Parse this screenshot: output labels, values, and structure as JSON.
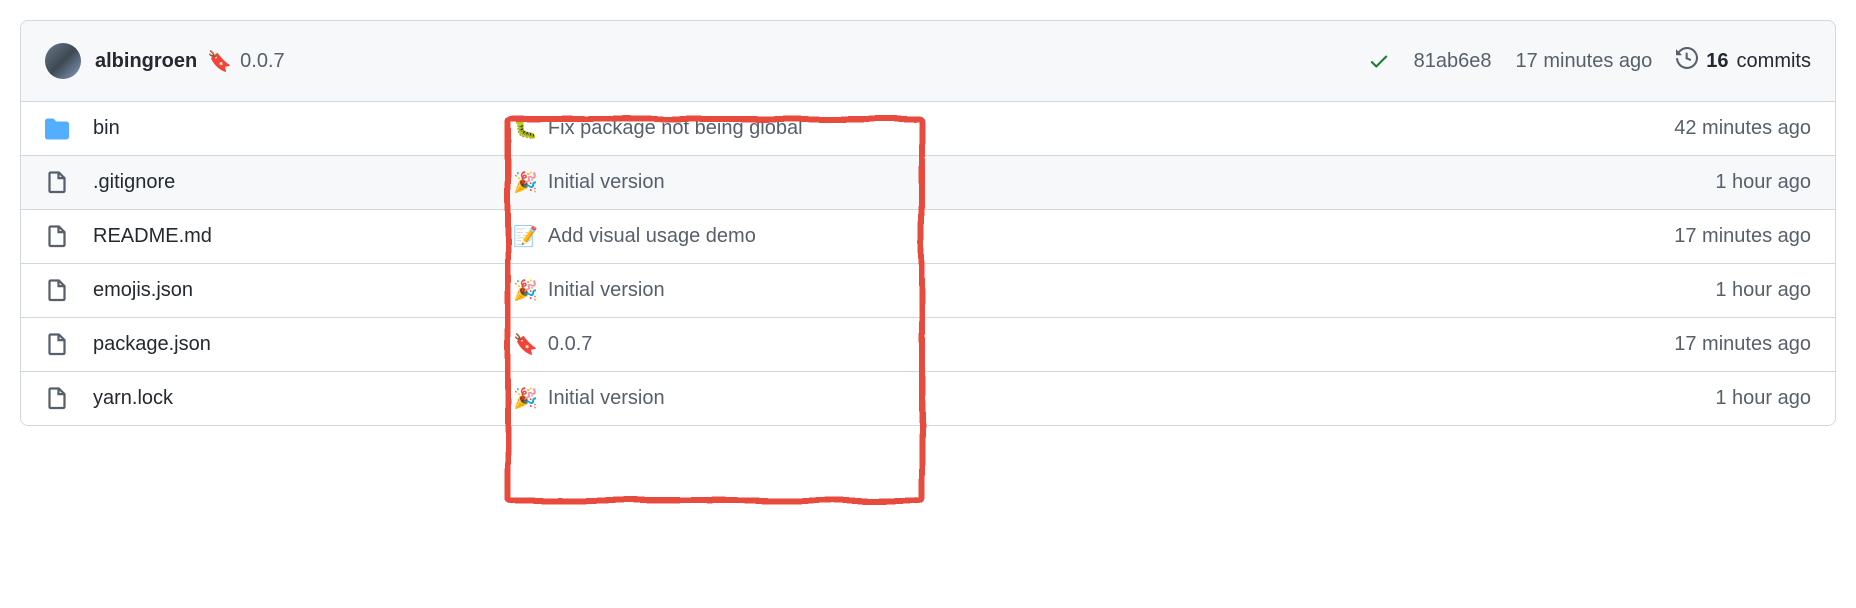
{
  "header": {
    "author": "albingroen",
    "latest_commit_emoji": "🔖",
    "latest_commit_text": "0.0.7",
    "commit_hash": "81ab6e8",
    "commit_time": "17 minutes ago",
    "commits_count": "16",
    "commits_label": "commits"
  },
  "files": [
    {
      "type": "folder",
      "name": "bin",
      "commit_emoji": "🐛",
      "commit_msg": "Fix package not being global",
      "time": "42 minutes ago"
    },
    {
      "type": "file",
      "name": ".gitignore",
      "commit_emoji": "🎉",
      "commit_msg": "Initial version",
      "time": "1 hour ago"
    },
    {
      "type": "file",
      "name": "README.md",
      "commit_emoji": "📝",
      "commit_msg": "Add visual usage demo",
      "time": "17 minutes ago"
    },
    {
      "type": "file",
      "name": "emojis.json",
      "commit_emoji": "🎉",
      "commit_msg": "Initial version",
      "time": "1 hour ago"
    },
    {
      "type": "file",
      "name": "package.json",
      "commit_emoji": "🔖",
      "commit_msg": "0.0.7",
      "time": "17 minutes ago"
    },
    {
      "type": "file",
      "name": "yarn.lock",
      "commit_emoji": "🎉",
      "commit_msg": "Initial version",
      "time": "1 hour ago"
    }
  ]
}
